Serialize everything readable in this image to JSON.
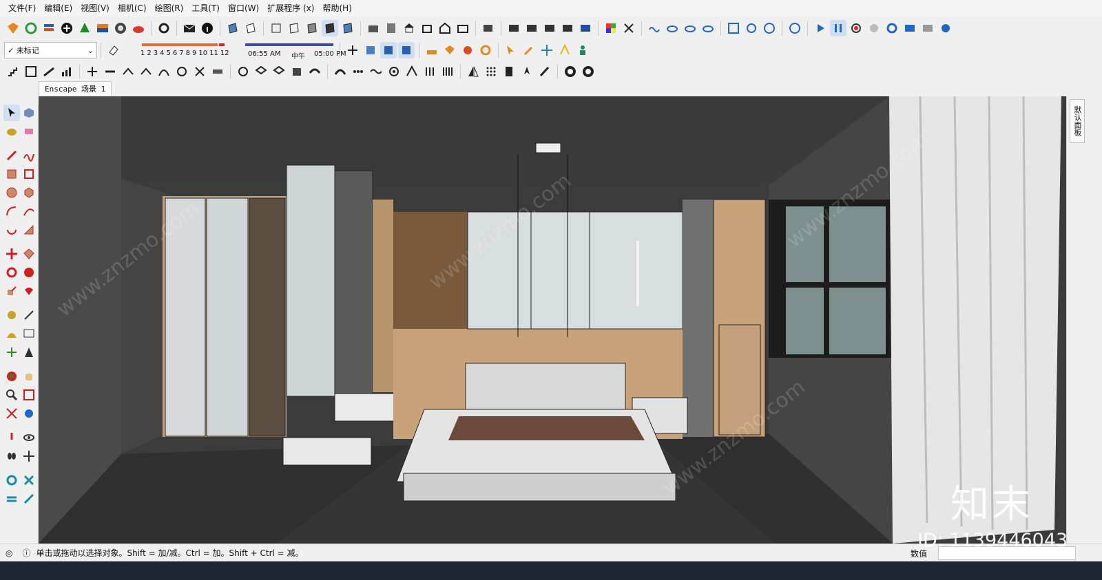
{
  "menu": [
    "文件(F)",
    "编辑(E)",
    "视图(V)",
    "相机(C)",
    "绘图(R)",
    "工具(T)",
    "窗口(W)",
    "扩展程序 (x)",
    "帮助(H)"
  ],
  "tag_selector": {
    "value": "未标记",
    "check": "✓"
  },
  "shadow": {
    "months": [
      "1",
      "2",
      "3",
      "4",
      "5",
      "6",
      "7",
      "8",
      "9",
      "10",
      "11",
      "12"
    ],
    "time_start": "06:55 AM",
    "noon": "中午",
    "time_end": "05:00 PM"
  },
  "scene_tab": "Enscape 场景 1",
  "tray_tab": "默认面板",
  "status": {
    "message": "单击或拖动以选择对象。Shift = 加/减。Ctrl = 加。Shift + Ctrl = 减。",
    "measure_label": "数值",
    "measure_value": ""
  },
  "watermark": {
    "logo": "知末",
    "id": "ID: 1139446043",
    "url": "www.znzmo.com"
  },
  "colors": {
    "wall": "#3c3c3c",
    "wood": "#c8a37a",
    "marble": "#d8dde0",
    "floor": "#2e2e2e",
    "accent_blue": "#1f66c9"
  }
}
